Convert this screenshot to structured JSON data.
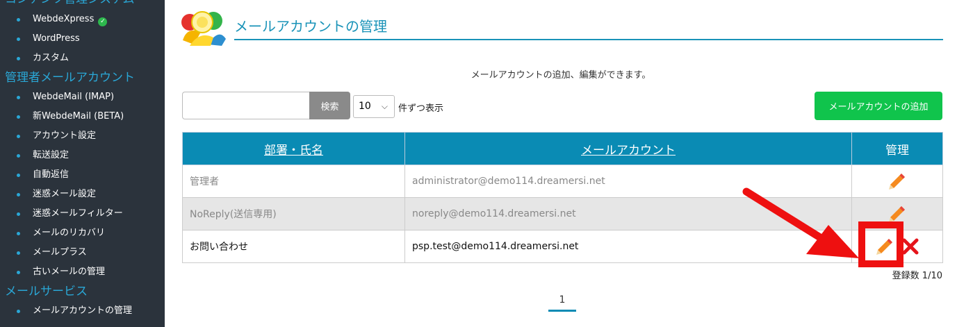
{
  "sidebar": {
    "sections": [
      {
        "title": "コンテンツ管理システム",
        "items": [
          {
            "label": "WebdeXpress",
            "verified": true
          },
          {
            "label": "WordPress"
          },
          {
            "label": "カスタム"
          }
        ]
      },
      {
        "title": "管理者メールアカウント",
        "items": [
          {
            "label": "WebdeMail (IMAP)"
          },
          {
            "label": "新WebdeMail (BETA)"
          },
          {
            "label": "アカウント設定"
          },
          {
            "label": "転送設定"
          },
          {
            "label": "自動返信"
          },
          {
            "label": "迷惑メール設定"
          },
          {
            "label": "迷惑メールフィルター"
          },
          {
            "label": "メールのリカバリ"
          },
          {
            "label": "メールプラス"
          },
          {
            "label": "古いメールの管理"
          }
        ]
      },
      {
        "title": "メールサービス",
        "items": [
          {
            "label": "メールアカウントの管理"
          }
        ]
      }
    ]
  },
  "page": {
    "title": "メールアカウントの管理",
    "subtitle": "メールアカウントの追加、編集ができます。"
  },
  "toolbar": {
    "search_value": "",
    "search_label": "検索",
    "per_page": "10",
    "per_page_suffix": "件ずつ表示",
    "add_label": "メールアカウントの追加"
  },
  "table": {
    "headers": [
      "部署・氏名",
      "メールアカウント",
      "管理"
    ],
    "rows": [
      {
        "name": "管理者",
        "email": "administrator@demo114.dreamersi.net"
      },
      {
        "name": "NoReply(送信専用)",
        "email": "noreply@demo114.dreamersi.net"
      },
      {
        "name": "お問い合わせ",
        "email": "psp.test@demo114.dreamersi.net"
      }
    ]
  },
  "footer": {
    "count": "登録数 1/10",
    "page": "1"
  },
  "colors": {
    "sidebar_bg": "#2b333c",
    "accent": "#0a8bb4",
    "add_button": "#10c44c",
    "annotation": "#ee1010"
  },
  "icons": {
    "edit": "pencil-icon",
    "delete": "close-icon",
    "verified": "check-circle-icon"
  }
}
